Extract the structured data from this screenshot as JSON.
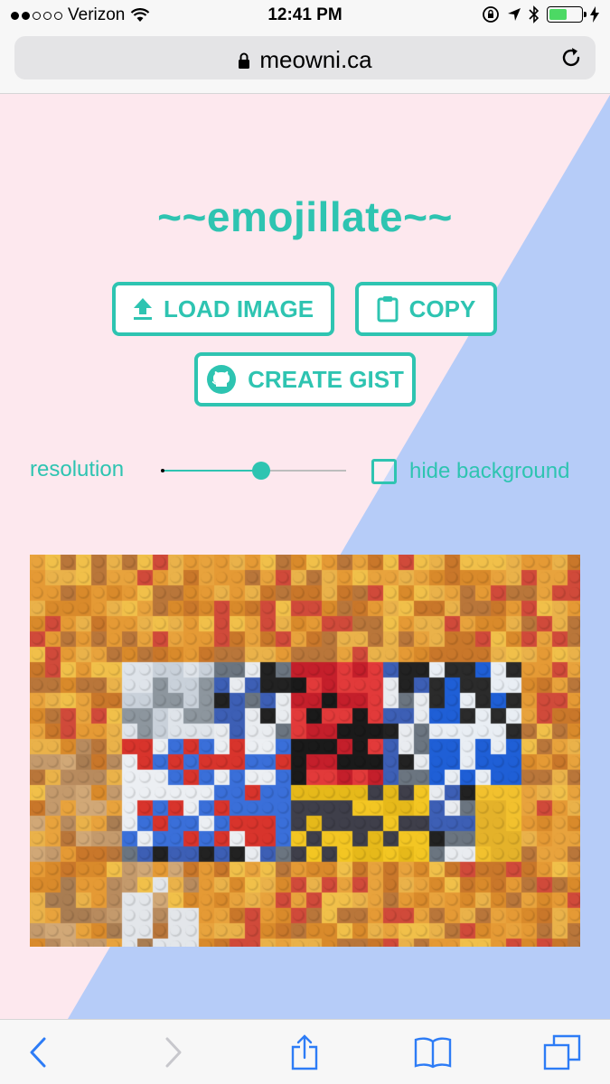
{
  "status_bar": {
    "carrier": "Verizon",
    "time": "12:41 PM",
    "battery_level": 0.55,
    "battery_color": "#4cd964"
  },
  "browser": {
    "url": "meowni.ca",
    "icons": [
      "lock-icon",
      "reload-icon"
    ]
  },
  "app": {
    "title": "~~emojillate~~",
    "accent_color": "#2ec4b1",
    "background_left": "#fde8ee",
    "background_right": "#b6ccf8",
    "buttons": {
      "load_image": "LOAD IMAGE",
      "copy": "COPY",
      "create_gist": "CREATE GIST"
    },
    "controls": {
      "resolution_label": "resolution",
      "resolution_value": 0.54,
      "hide_background_label": "hide background",
      "hide_background_checked": false
    },
    "mosaic": {
      "description_icon": "emoji-mosaic-image"
    }
  },
  "toolbar": {
    "icons": [
      "back-icon",
      "forward-icon",
      "share-icon",
      "bookmarks-icon",
      "tabs-icon"
    ]
  }
}
